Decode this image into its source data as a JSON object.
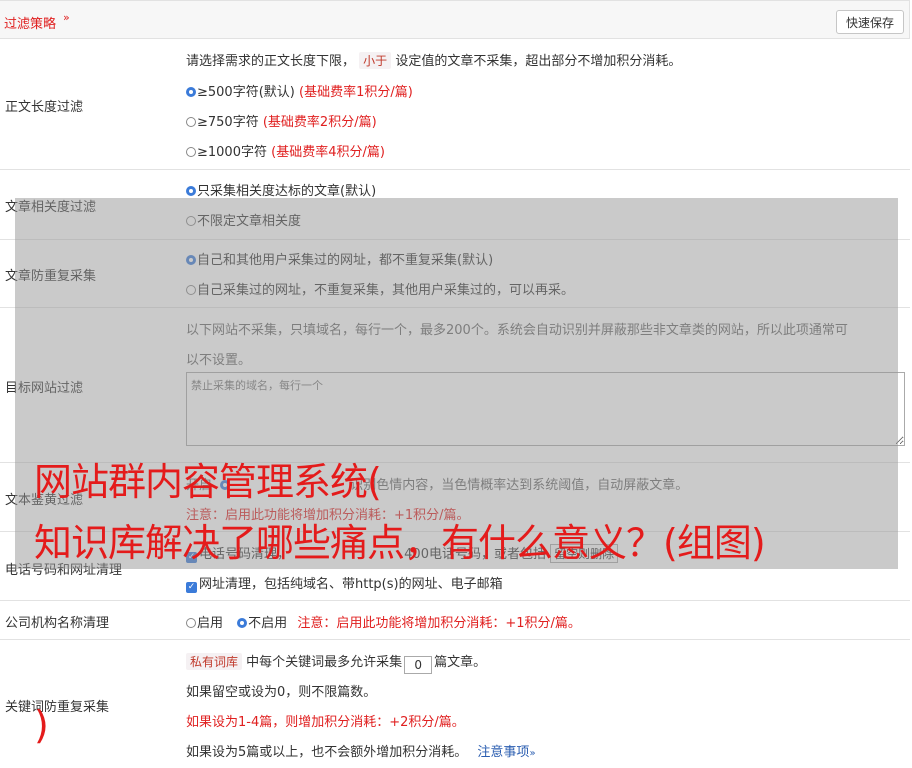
{
  "header": {
    "title": "过滤策略",
    "chevron": "»",
    "save_label": "快速保存"
  },
  "length_filter": {
    "label": "正文长度过滤",
    "intro_prefix": "请选择需求的正文长度下限，",
    "intro_tag": "小于",
    "intro_suffix": "设定值的文章不采集，超出部分不增加积分消耗。",
    "options": [
      {
        "text": "≥500字符(默认)",
        "rate": "(基础费率1积分/篇)",
        "selected": true
      },
      {
        "text": "≥750字符",
        "rate": "(基础费率2积分/篇)",
        "selected": false
      },
      {
        "text": "≥1000字符",
        "rate": "(基础费率4积分/篇)",
        "selected": false
      }
    ]
  },
  "relevance_filter": {
    "label": "文章相关度过滤",
    "options": [
      {
        "text": "只采集相关度达标的文章(默认)",
        "selected": true
      },
      {
        "text": "不限定文章相关度",
        "selected": false
      }
    ]
  },
  "duplicate_filter": {
    "label": "文章防重复采集",
    "options": [
      {
        "text": "自己和其他用户采集过的网址，都不重复采集(默认)",
        "selected": true
      },
      {
        "text": "自己采集过的网址，不重复采集，其他用户采集过的，可以再采。",
        "selected": false
      }
    ]
  },
  "site_filter": {
    "label": "目标网站过滤",
    "desc_line1": "以下网站不采集，只填域名，每行一个，最多200个。系统会自动识别并屏蔽那些非文章类的网站，所以此项通常可",
    "desc_line2": "以不设置。",
    "placeholder": "禁止采集的域名，每行一个"
  },
  "porn_filter": {
    "label": "文本鉴黄过滤",
    "line1_prefix": "开启",
    "line1_rest": "识别色情内容，当色情概率达到系统阈值，自动屏蔽文章。",
    "note": "注意：启用此功能将增加积分消耗：+1积分/篇。"
  },
  "phone_filter": {
    "label": "电话号码和网址清理",
    "phone_text": "电话号码清理，",
    "phone_rest": "400电话号码，或者包括",
    "clear_btn": "留空则删除",
    "url_text": "网址清理，包括纯域名、带http(s)的网址、电子邮箱"
  },
  "org_filter": {
    "label": "公司机构名称清理",
    "enable": "启用",
    "disable": "不启用",
    "note": "注意：启用此功能将增加积分消耗：+1积分/篇。"
  },
  "keyword_dup": {
    "label": "关键词防重复采集",
    "tag": "私有词库",
    "line1_mid": "中每个关键词最多允许采集",
    "count": "0",
    "line1_end": "篇文章。",
    "line2": "如果留空或设为0，则不限篇数。",
    "line3": "如果设为1-4篇，则增加积分消耗：+2积分/篇。",
    "line4": "如果设为5篇或以上，也不会额外增加积分消耗。",
    "note_link": "注意事项"
  },
  "watermark": {
    "line1": "网站群内容管理系统(",
    "line2": "知识库解决了哪些痛点，有什么意义？(组图)",
    "line3": ")"
  }
}
